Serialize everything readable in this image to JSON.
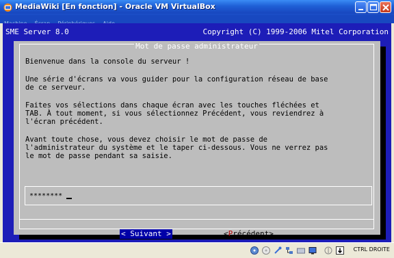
{
  "window": {
    "title": "MediaWiki [En fonction] - Oracle VM VirtualBox",
    "menu": [
      "Machine",
      "Écran",
      "Périphériques",
      "Aide"
    ]
  },
  "console": {
    "header_left": "SME Server 8.0",
    "header_right": "Copyright (C) 1999-2006 Mitel Corporation",
    "dialog": {
      "title": "Mot de passe administrateur",
      "lines": [
        "Bienvenue dans la console du serveur !",
        "Une série d'écrans va vous guider pour la configuration réseau de base",
        "de ce serveur.",
        "Faites vos sélections dans chaque écran avec les touches fléchées et",
        "TAB. À tout moment, si vous sélectionnez Précédent, vous reviendrez à",
        "l'écran précédent.",
        "Avant toute chose, vous devez choisir le mot de passe de",
        "l'administrateur du système et le taper ci-dessous. Vous ne verrez pas",
        "le mot de passe pendant sa saisie."
      ],
      "password_value": "********",
      "next_button": "< Suivant >",
      "prev_button_open": "<",
      "prev_button_hotkey": "P",
      "prev_button_rest": "récédent>"
    }
  },
  "statusbar": {
    "host_key": "CTRL DROITE"
  },
  "colors": {
    "console_bg": "#1d1db8",
    "dialog_bg": "#bdbdbd",
    "focused_button": "#0000a8",
    "hotkey": "#b00000"
  }
}
